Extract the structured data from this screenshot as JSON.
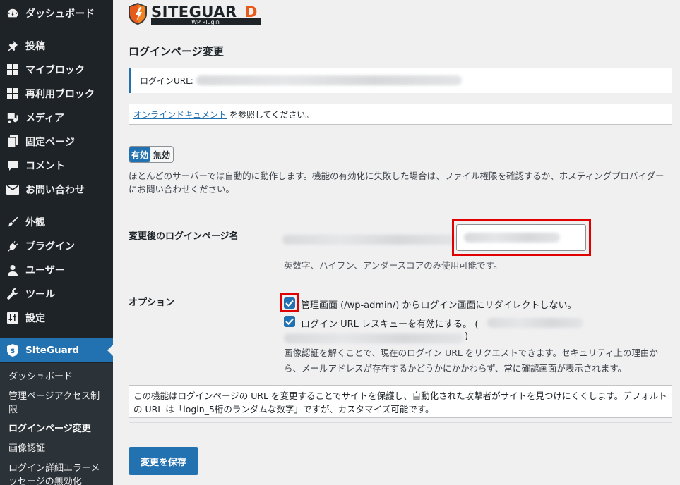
{
  "sidebar": {
    "items": [
      {
        "label": "ダッシュボード",
        "icon": "dashboard-icon"
      },
      {
        "label": "投稿",
        "icon": "pin-icon"
      },
      {
        "label": "マイブロック",
        "icon": "blocks-icon"
      },
      {
        "label": "再利用ブロック",
        "icon": "blocks-icon"
      },
      {
        "label": "メディア",
        "icon": "media-icon"
      },
      {
        "label": "固定ページ",
        "icon": "page-icon"
      },
      {
        "label": "コメント",
        "icon": "comment-icon"
      },
      {
        "label": "お問い合わせ",
        "icon": "mail-icon"
      },
      {
        "label": "外観",
        "icon": "brush-icon"
      },
      {
        "label": "プラグイン",
        "icon": "plugin-icon"
      },
      {
        "label": "ユーザー",
        "icon": "user-icon"
      },
      {
        "label": "ツール",
        "icon": "wrench-icon"
      },
      {
        "label": "設定",
        "icon": "settings-icon"
      },
      {
        "label": "SiteGuard",
        "icon": "siteguard-icon"
      }
    ],
    "submenu": [
      "ダッシュボード",
      "管理ページアクセス制限",
      "ログインページ変更",
      "画像認証",
      "ログイン詳細エラーメッセージの無効化"
    ]
  },
  "logo": {
    "name": "SITEGUARD",
    "sub": "WP Plugin"
  },
  "page": {
    "title": "ログインページ変更",
    "login_url_label": "ログインURL:",
    "doc_link": "オンラインドキュメント",
    "doc_suffix": "を参照してください。",
    "toggle_on": "有効",
    "toggle_off": "無効",
    "toggle_desc": "ほとんどのサーバーでは自動的に動作します。機能の有効化に失敗した場合は、ファイル権限を確認するか、ホスティングプロバイダーにお問い合わせください。",
    "rename_label": "変更後のログインページ名",
    "rename_hint": "英数字、ハイフン、アンダースコアのみ使用可能です。",
    "option_label": "オプション",
    "option1": "管理画面 (/wp-admin/) からログイン画面にリダイレクトしない。",
    "option2": "ログイン URL レスキューを有効にする。 (",
    "option2_close": ")",
    "option_desc": "画像認証を解くことで、現在のログイン URL をリクエストできます。セキュリティ上の理由から、メールアドレスが存在するかどうかにかかわらず、常に確認画面が表示されます。",
    "info": "この機能はログインページの URL を変更することでサイトを保護し、自動化された攻撃者がサイトを見つけにくくします。デフォルトの URL は「login_5桁のランダムな数字」ですが、カスタマイズ可能です。",
    "save_label": "変更を保存"
  },
  "colors": {
    "accent": "#2271b1",
    "sidebar_bg": "#1d2327",
    "highlight": "#e00000"
  }
}
